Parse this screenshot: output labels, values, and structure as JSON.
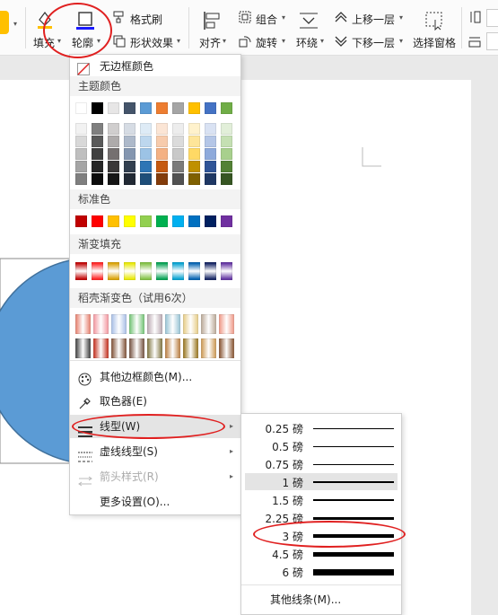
{
  "ribbon": {
    "fill_label": "填充",
    "outline_label": "轮廓",
    "format_brush_label": "格式刷",
    "shape_effect_label": "形状效果",
    "align_label": "对齐",
    "group_label": "组合",
    "rotate_label": "旋转",
    "wrap_label": "环绕",
    "bring_forward_label": "上移一层",
    "send_backward_label": "下移一层",
    "selection_pane_label": "选择窗格"
  },
  "menu": {
    "no_border": "无边框颜色",
    "theme_colors_header": "主题颜色",
    "standard_colors_header": "标准色",
    "gradient_fill_header": "渐变填充",
    "docer_gradient_header": "稻壳渐变色（试用6次）",
    "more_colors": "其他边框颜色(M)...",
    "eyedropper": "取色器(E)",
    "line_type": "线型(W)",
    "dash_type": "虚线线型(S)",
    "arrow_style": "箭头样式(R)",
    "more_settings": "更多设置(O)..."
  },
  "colors": {
    "theme_top": [
      "#ffffff",
      "#000000",
      "#e7e6e6",
      "#44546a",
      "#5b9bd5",
      "#ed7d31",
      "#a5a5a5",
      "#ffc000",
      "#4472c4",
      "#70ad47"
    ],
    "theme_grid": [
      [
        "#f2f2f2",
        "#7f7f7f",
        "#d0cece",
        "#d6dce4",
        "#deebf6",
        "#fbe5d5",
        "#ededed",
        "#fff2cc",
        "#d9e2f3",
        "#e2efd9"
      ],
      [
        "#d8d8d8",
        "#595959",
        "#aeabab",
        "#adb9ca",
        "#bdd7ee",
        "#f7cbac",
        "#dbdbdb",
        "#fee599",
        "#b4c6e7",
        "#c5e0b3"
      ],
      [
        "#bfbfbf",
        "#3f3f3f",
        "#757070",
        "#8496b0",
        "#9cc3e5",
        "#f4b183",
        "#c9c9c9",
        "#ffd965",
        "#8eaadb",
        "#a8d08d"
      ],
      [
        "#a5a5a5",
        "#262626",
        "#3a3838",
        "#323f4f",
        "#2e75b5",
        "#c55a11",
        "#7b7b7b",
        "#bf9000",
        "#2f5496",
        "#538135"
      ],
      [
        "#7f7f7f",
        "#0c0c0c",
        "#161616",
        "#222a35",
        "#1e4e79",
        "#833c0b",
        "#525252",
        "#7f6000",
        "#1f3864",
        "#375623"
      ]
    ],
    "standard": [
      "#c00000",
      "#ff0000",
      "#ffc000",
      "#ffff00",
      "#92d050",
      "#00b050",
      "#00b0f0",
      "#0070c0",
      "#002060",
      "#7030a0"
    ],
    "gradient": [
      "#c00000",
      "#ff2020",
      "#d9a000",
      "#e8e800",
      "#7fc040",
      "#00a050",
      "#00a0d0",
      "#0060b0",
      "#102060",
      "#6030a0"
    ],
    "docer_row1": [
      "#e88a7a",
      "#f4a0a8",
      "#b0c4e8",
      "#7ec880",
      "#c0b0b8",
      "#a0c8d8",
      "#e8d090",
      "#c0b0a0",
      "#f0a090"
    ],
    "docer_row2": [
      "#505050",
      "#c84030",
      "#8a6048",
      "#806050",
      "#8a8050",
      "#c08850",
      "#a08030",
      "#d0a060",
      "#906040"
    ]
  },
  "linetype_submenu": {
    "items": [
      "0.25 磅",
      "0.5 磅",
      "0.75 磅",
      "1 磅",
      "1.5 磅",
      "2.25 磅",
      "3 磅",
      "4.5 磅",
      "6 磅"
    ],
    "selected": "1 磅",
    "more_lines": "其他线条(M)..."
  }
}
